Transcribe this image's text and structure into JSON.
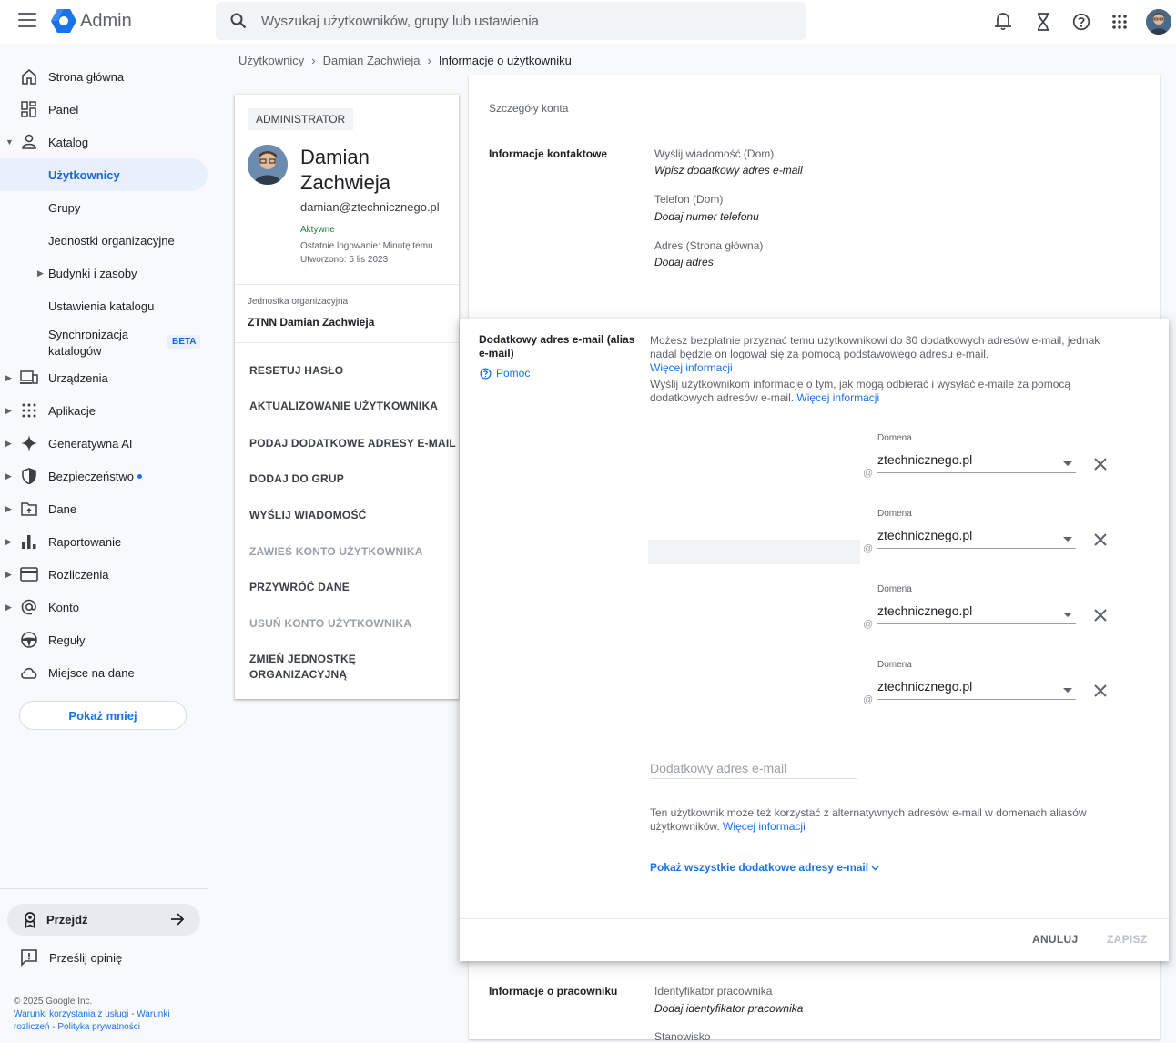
{
  "header": {
    "app_title": "Admin",
    "search_placeholder": "Wyszukaj użytkowników, grupy lub ustawienia",
    "icons": [
      "notifications-icon",
      "hourglass-icon",
      "help-icon",
      "apps-grid-icon",
      "account-avatar"
    ]
  },
  "breadcrumb": {
    "items": [
      "Użytkownicy",
      "Damian Zachwieja"
    ],
    "separator": "›",
    "current": "Informacje o użytkowniku"
  },
  "sidebar": {
    "items": [
      {
        "label": "Strona główna",
        "icon": "home-icon"
      },
      {
        "label": "Panel",
        "icon": "dashboard-icon"
      },
      {
        "label": "Katalog",
        "icon": "person-icon",
        "expanded": true
      },
      {
        "label": "Użytkownicy",
        "active": true
      },
      {
        "label": "Grupy"
      },
      {
        "label": "Jednostki organizacyjne"
      },
      {
        "label": "Budynki i zasoby",
        "expandable": true
      },
      {
        "label": "Ustawienia katalogu"
      },
      {
        "label": "Synchronizacja katalogów",
        "badge": "BETA"
      },
      {
        "label": "Urządzenia",
        "icon": "devices-icon",
        "expandable": true
      },
      {
        "label": "Aplikacje",
        "icon": "apps-icon",
        "expandable": true
      },
      {
        "label": "Generatywna AI",
        "icon": "sparkle-icon",
        "expandable": true
      },
      {
        "label": "Bezpieczeństwo",
        "icon": "shield-icon",
        "expandable": true,
        "dot": true
      },
      {
        "label": "Dane",
        "icon": "folder-icon",
        "expandable": true
      },
      {
        "label": "Raportowanie",
        "icon": "bar-chart-icon",
        "expandable": true
      },
      {
        "label": "Rozliczenia",
        "icon": "credit-card-icon",
        "expandable": true
      },
      {
        "label": "Konto",
        "icon": "at-sign-icon",
        "expandable": true
      },
      {
        "label": "Reguły",
        "icon": "steering-wheel-icon"
      },
      {
        "label": "Miejsce na dane",
        "icon": "cloud-icon"
      }
    ],
    "show_less": "Pokaż mniej",
    "goto": "Przejdź",
    "feedback": "Prześlij opinię",
    "footer": {
      "copyright": "© 2025 Google Inc.",
      "terms": "Warunki korzystania z usługi",
      "billing": "Warunki rozliczeń",
      "privacy": "Polityka prywatności"
    }
  },
  "user_card": {
    "role": "ADMINISTRATOR",
    "name": "Damian Zachwieja",
    "email": "damian@ztechnicznego.pl",
    "status": "Aktywne",
    "last_login": "Ostatnie logowanie: Minutę temu",
    "created": "Utworzono: 5 lis 2023",
    "org_unit_label": "Jednostka organizacyjna",
    "org_unit_value": "ZTNN Damian Zachwieja",
    "actions": [
      {
        "label": "RESETUJ HASŁO",
        "enabled": true
      },
      {
        "label": "AKTUALIZOWANIE UŻYTKOWNIKA",
        "enabled": true
      },
      {
        "label": "PODAJ DODATKOWE ADRESY E-MAIL",
        "enabled": true
      },
      {
        "label": "DODAJ DO GRUP",
        "enabled": true
      },
      {
        "label": "WYŚLIJ WIADOMOŚĆ",
        "enabled": true
      },
      {
        "label": "ZAWIEŚ KONTO UŻYTKOWNIKA",
        "enabled": false
      },
      {
        "label": "PRZYWRÓĆ DANE",
        "enabled": true
      },
      {
        "label": "USUŃ KONTO UŻYTKOWNIKA",
        "enabled": false
      },
      {
        "label": "ZMIEŃ JEDNOSTKĘ ORGANIZACYJNĄ",
        "enabled": true
      }
    ]
  },
  "details": {
    "section_title": "Szczegóły konta",
    "contact_label": "Informacje kontaktowe",
    "contact_fields": [
      {
        "label": "Wyślij wiadomość (Dom)",
        "value": "Wpisz dodatkowy adres e-mail"
      },
      {
        "label": "Telefon (Dom)",
        "value": "Dodaj numer telefonu"
      },
      {
        "label": "Adres (Strona główna)",
        "value": "Dodaj adres"
      }
    ],
    "employee_label": "Informacje o pracowniku",
    "employee_fields": [
      {
        "label": "Identyfikator pracownika",
        "value": "Dodaj identyfikator pracownika"
      },
      {
        "label": "Stanowisko",
        "value": ""
      }
    ]
  },
  "alias_dialog": {
    "title": "Dodatkowy adres e-mail (alias e-mail)",
    "help": "Pomoc",
    "desc1": "Możesz bezpłatnie przyznać temu użytkownikowi do 30 dodatkowych adresów e-mail, jednak nadal będzie on logował się za pomocą podstawowego adresu e-mail.",
    "more_info": "Więcej informacji",
    "desc2": "Wyślij użytkownikom informacje o tym, jak mogą odbierać i wysyłać e-maile za pomocą dodatkowych adresów e-mail.",
    "domain_label": "Domena",
    "at": "@",
    "aliases": [
      {
        "domain": "ztechnicznego.pl"
      },
      {
        "domain": "ztechnicznego.pl"
      },
      {
        "domain": "ztechnicznego.pl"
      },
      {
        "domain": "ztechnicznego.pl"
      }
    ],
    "extra_placeholder": "Dodatkowy adres e-mail",
    "alt_note": "Ten użytkownik może też korzystać z alternatywnych adresów e-mail w domenach aliasów użytkowników.",
    "show_all": "Pokaż wszystkie dodatkowe adresy e-mail",
    "cancel": "ANULUJ",
    "save": "ZAPISZ",
    "colors": {
      "accent": "#1a73e8",
      "disabled": "#9aa0a6"
    }
  }
}
